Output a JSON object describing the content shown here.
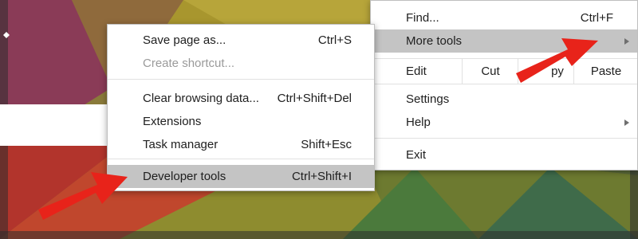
{
  "main_menu": {
    "find_label": "Find...",
    "find_shortcut": "Ctrl+F",
    "more_tools_label": "More tools",
    "edit_label": "Edit",
    "cut_label": "Cut",
    "copy_label": "py",
    "paste_label": "Paste",
    "settings_label": "Settings",
    "help_label": "Help",
    "exit_label": "Exit"
  },
  "submenu": {
    "items": [
      {
        "label": "Save page as...",
        "shortcut": "Ctrl+S"
      },
      {
        "label": "Create shortcut...",
        "shortcut": ""
      },
      {
        "label": "Clear browsing data...",
        "shortcut": "Ctrl+Shift+Del"
      },
      {
        "label": "Extensions",
        "shortcut": ""
      },
      {
        "label": "Task manager",
        "shortcut": "Shift+Esc"
      },
      {
        "label": "Developer tools",
        "shortcut": "Ctrl+Shift+I"
      }
    ]
  },
  "colors": {
    "highlight": "#c4c4c4",
    "arrow_red": "#e8231a",
    "disabled_text": "#9a9a9a"
  },
  "icons": {
    "submenu_arrow": "triangle-right-icon",
    "annotation": "red-arrow-icon"
  }
}
